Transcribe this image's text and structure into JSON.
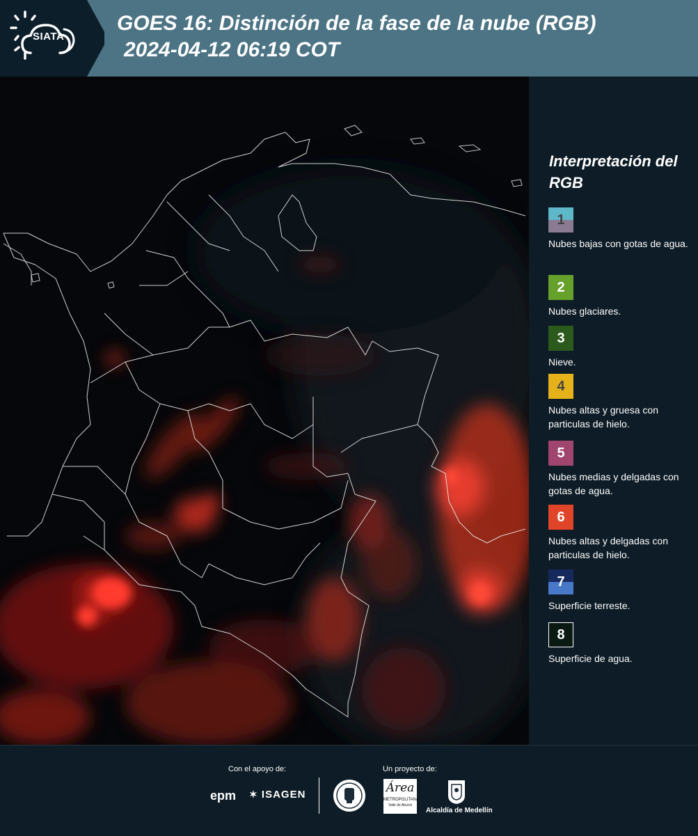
{
  "header": {
    "logo_text": "SIATA",
    "title": "GOES 16: Distinción de la fase de la nube (RGB)",
    "subtitle": "2024-04-12 06:19 COT"
  },
  "legend": {
    "title": "Interpretación del RGB",
    "items": [
      {
        "number": "1",
        "label": "Nubes bajas con gotas de agua.",
        "color_top": "#5fb8c8",
        "color_bottom": "#8a7a92"
      },
      {
        "number": "2",
        "label": "Nubes glaciares.",
        "color": "#66a12c"
      },
      {
        "number": "3",
        "label": "Nieve.",
        "color": "#2c5a1c"
      },
      {
        "number": "4",
        "label": "Nubes altas y gruesa con particulas de hielo.",
        "color": "#e5b21a"
      },
      {
        "number": "5",
        "label": "Nubes medias y delgadas con gotas de agua.",
        "color": "#a0456e"
      },
      {
        "number": "6",
        "label": "Nubes altas y delgadas con particulas de hielo.",
        "color": "#e0452a"
      },
      {
        "number": "7",
        "label": "Superficie terreste.",
        "color_top": "#16295c",
        "color_bottom": "#4878c8"
      },
      {
        "number": "8",
        "label": "Superficie de agua.",
        "color": "#0a1a12"
      }
    ]
  },
  "footer": {
    "support_label": "Con el apoyo de:",
    "project_label": "Un proyecto de:",
    "partners": {
      "epm": "epm",
      "isagen": "ISAGEN",
      "area_metropolitana": "Área",
      "area_sub": "METROPOLITANA",
      "area_sub2": "Valle de Aburrá",
      "alcaldia": "Alcaldía de Medellín"
    }
  }
}
